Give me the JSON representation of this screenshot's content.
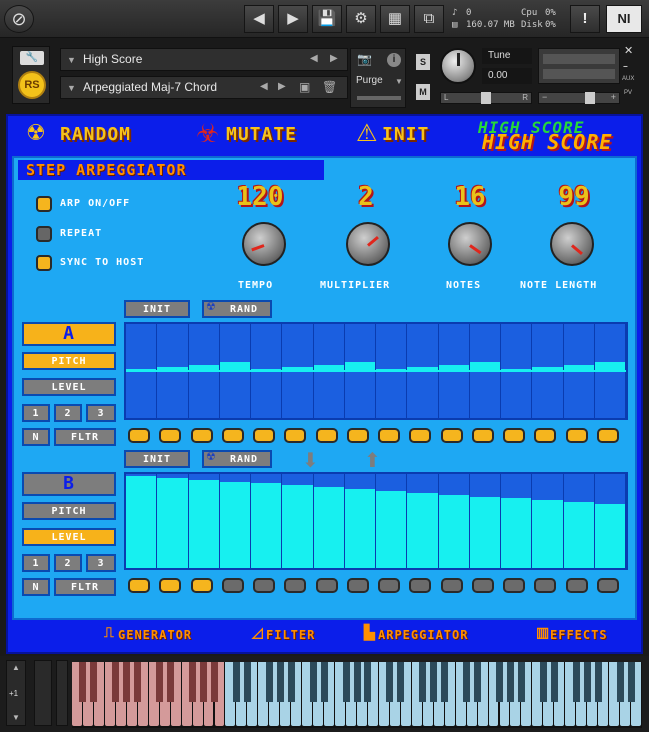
{
  "topbar": {
    "logo_icon": "kontakt-logo-icon",
    "stats": {
      "midi": "0",
      "memory": "160.07 MB",
      "cpu_label": "Cpu",
      "cpu": "0%",
      "disk_label": "Disk",
      "disk": "0%"
    },
    "brand": "NI"
  },
  "instrument": {
    "title": "High Score",
    "preset": "Arpeggiated Maj-7 Chord",
    "purge_label": "Purge",
    "tune_label": "Tune",
    "tune_value": "0.00",
    "s_label": "S",
    "m_label": "M",
    "pan_left": "L",
    "pan_right": "R",
    "aux_label": "AUX",
    "pv_label": "PV"
  },
  "toolbar": {
    "random": "RANDOM",
    "mutate": "MUTATE",
    "init": "INIT",
    "logo_top": "HIGH SCORE",
    "logo_main": "HIGH SCORE"
  },
  "step_arp": {
    "title": "STEP ARPEGGIATOR",
    "toggles": [
      {
        "label": "ARP ON/OFF",
        "on": true
      },
      {
        "label": "REPEAT",
        "on": false
      },
      {
        "label": "SYNC TO HOST",
        "on": true
      }
    ],
    "knobs": [
      {
        "label": "TEMPO",
        "value": "120"
      },
      {
        "label": "MULTIPLIER",
        "value": "2"
      },
      {
        "label": "NOTES",
        "value": "16"
      },
      {
        "label": "NOTE LENGTH",
        "value": "99"
      }
    ]
  },
  "lane_a": {
    "letter": "A",
    "init": "INIT",
    "rand": "RAND",
    "mode_pitch": "PITCH",
    "mode_level": "LEVEL",
    "sh1": "1",
    "sh2": "2",
    "sh3": "3",
    "rn": "N",
    "fltr": "FLTR",
    "active_mode": "pitch",
    "steps": [
      0.0,
      0.04,
      0.06,
      0.1,
      0.0,
      0.04,
      0.06,
      0.1,
      0.0,
      0.04,
      0.06,
      0.1,
      0.0,
      0.04,
      0.06,
      0.1
    ],
    "pads": [
      1,
      1,
      1,
      1,
      1,
      1,
      1,
      1,
      1,
      1,
      1,
      1,
      1,
      1,
      1,
      1
    ]
  },
  "lane_b": {
    "letter": "B",
    "init": "INIT",
    "rand": "RAND",
    "mode_pitch": "PITCH",
    "mode_level": "LEVEL",
    "sh1": "1",
    "sh2": "2",
    "sh3": "3",
    "rn": "N",
    "fltr": "FLTR",
    "active_mode": "level",
    "steps": [
      0.98,
      0.96,
      0.94,
      0.92,
      0.9,
      0.88,
      0.86,
      0.84,
      0.82,
      0.8,
      0.78,
      0.76,
      0.74,
      0.72,
      0.7,
      0.68
    ],
    "pads": [
      1,
      1,
      1,
      0,
      0,
      0,
      0,
      0,
      0,
      0,
      0,
      0,
      0,
      0,
      0,
      0
    ]
  },
  "bottom_nav": [
    "GENERATOR",
    "FILTER",
    "ARPEGGIATOR",
    "EFFECTS"
  ],
  "keyboard": {
    "octave": "+1"
  }
}
